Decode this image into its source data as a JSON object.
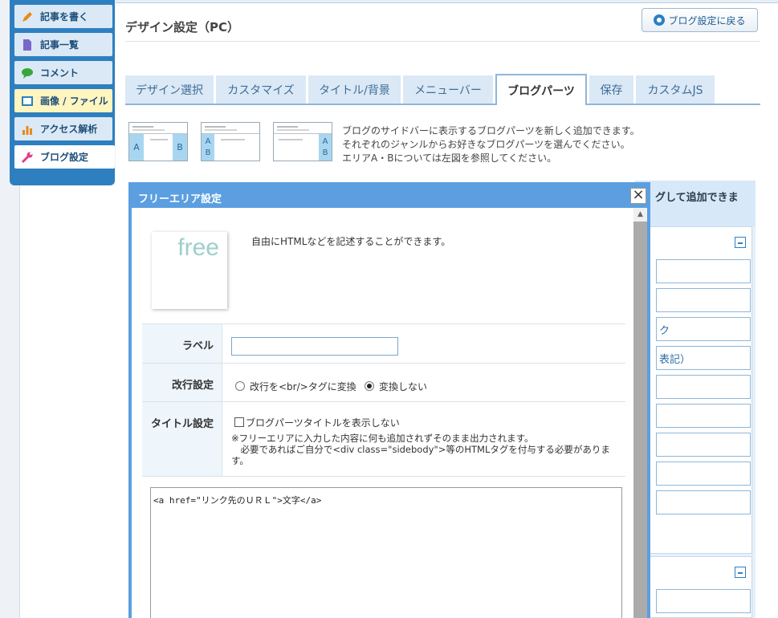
{
  "nav": {
    "items": [
      {
        "label": "記事を書く",
        "icon": "pencil-icon",
        "color": "#e88a1a"
      },
      {
        "label": "記事一覧",
        "icon": "document-icon",
        "color": "#7a67c9"
      },
      {
        "label": "コメント",
        "icon": "speech-bubble-icon",
        "color": "#3aa63a"
      },
      {
        "label": "画像 / ファイル",
        "icon": "image-icon",
        "color": "#2b7fc3"
      },
      {
        "label": "アクセス解析",
        "icon": "bar-chart-icon",
        "color": "#e88a1a"
      },
      {
        "label": "ブログ設定",
        "icon": "wrench-icon",
        "color": "#e23a8a"
      }
    ]
  },
  "header": {
    "title": "デザイン設定（PC）",
    "back_button": "ブログ設定に戻る"
  },
  "tabs": [
    "デザイン選択",
    "カスタマイズ",
    "タイトル/背景",
    "メニューバー",
    "ブログパーツ",
    "保存",
    "カスタムJS"
  ],
  "active_tab": "ブログパーツ",
  "diagrams": {
    "area_a": "A",
    "area_b": "B"
  },
  "description": [
    "ブログのサイドバーに表示するブログパーツを新しく追加できます。",
    "それぞれのジャンルからお好きなブログパーツを選んでください。",
    "エリアA・Bについては左図を参照してください。"
  ],
  "right_panel": {
    "header": "グして追加できま",
    "buttons": [
      "",
      "",
      "ク",
      "表記）",
      "",
      "",
      "",
      "",
      ""
    ]
  },
  "dialog": {
    "title": "フリーエリア設定",
    "close": "×",
    "image_text": "free",
    "description": "自由にHTMLなどを記述することができます。",
    "label_field": {
      "label": "ラベル",
      "value": ""
    },
    "linebreak": {
      "label": "改行設定",
      "option1": "改行を<br/>タグに変換",
      "option2": "変換しない",
      "selected": "option2"
    },
    "title_setting": {
      "label": "タイトル設定",
      "checkbox": "ブログパーツタイトルを表示しない",
      "checked": false,
      "note_line1": "※フリーエリアに入力した内容に何も追加されずそのまま出力されます。",
      "note_line2": "　必要であればご自分で<div class=\"sidebody\">等のHTMLタグを付与する必要があります。"
    },
    "code": "<a href=\"リンク先のＵＲＬ\">文字</a>"
  },
  "colors": {
    "nav_bg": "#2e7fc0",
    "dialog_border": "#5b9fe0",
    "tab_bg": "#dbe8f5"
  }
}
